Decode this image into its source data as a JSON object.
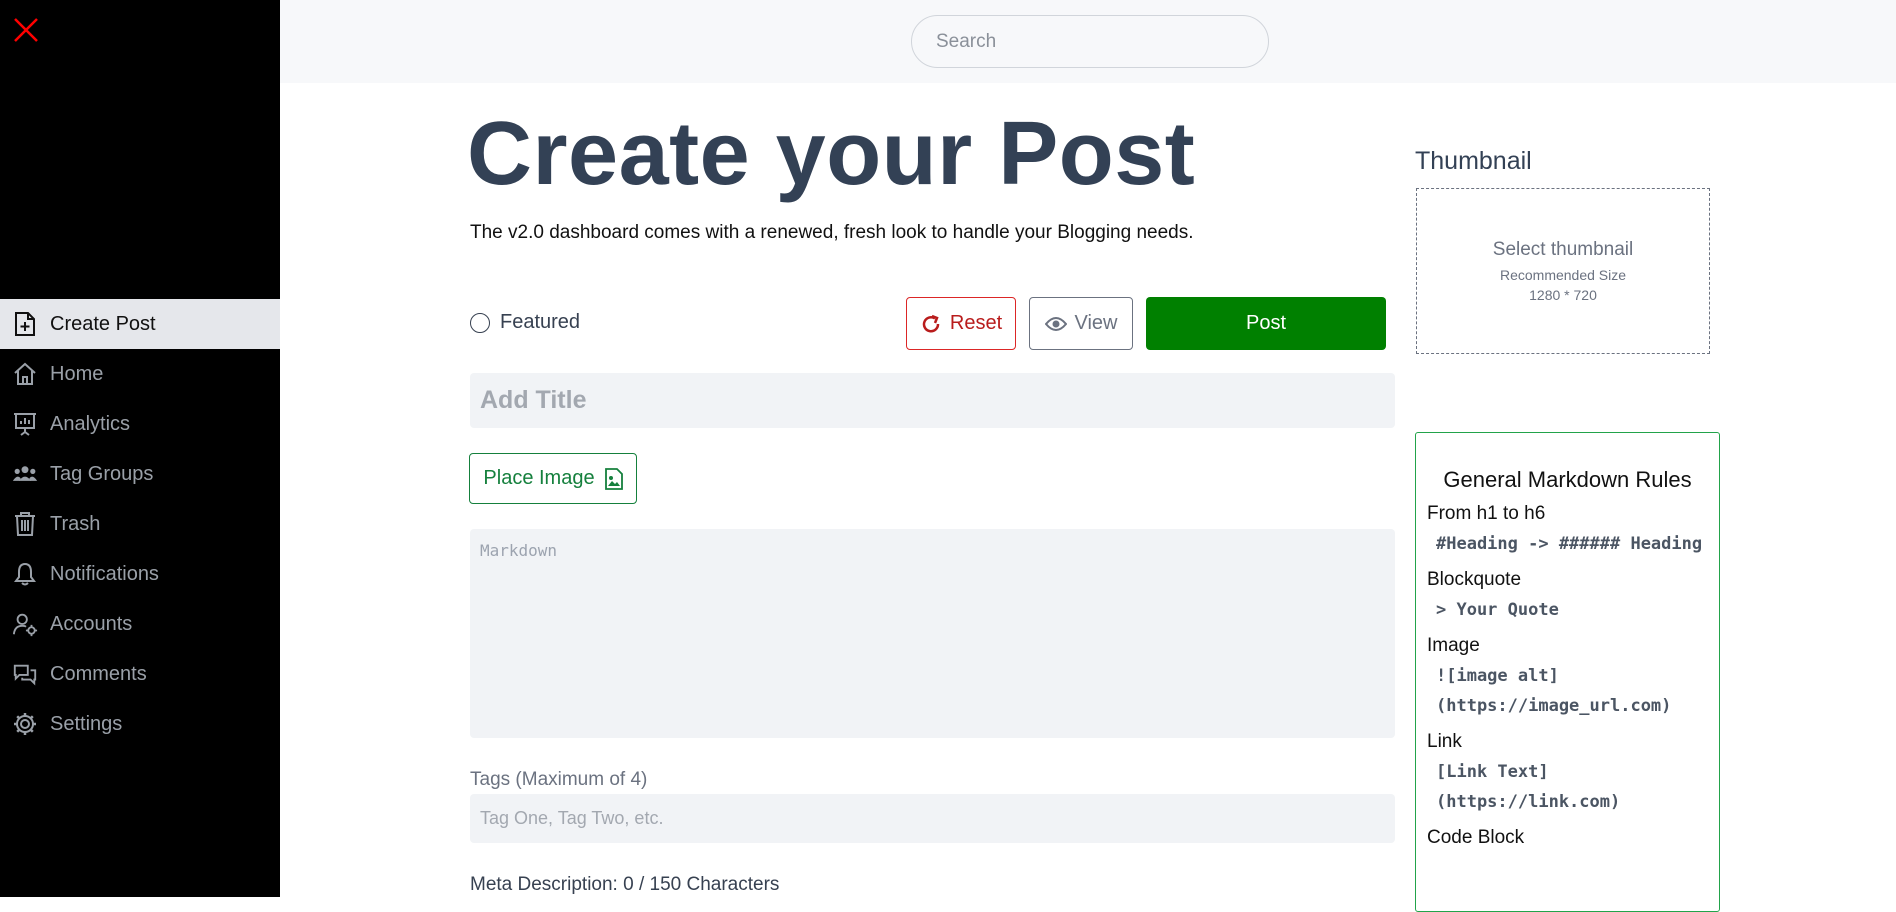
{
  "search": {
    "placeholder": "Search"
  },
  "sidebar": {
    "items": [
      {
        "label": "Create Post",
        "icon": "file-plus-icon",
        "active": true
      },
      {
        "label": "Home",
        "icon": "home-icon"
      },
      {
        "label": "Analytics",
        "icon": "presentation-chart-icon"
      },
      {
        "label": "Tag Groups",
        "icon": "users-icon"
      },
      {
        "label": "Trash",
        "icon": "trash-icon"
      },
      {
        "label": "Notifications",
        "icon": "bell-icon"
      },
      {
        "label": "Accounts",
        "icon": "user-cog-icon"
      },
      {
        "label": "Comments",
        "icon": "chat-icon"
      },
      {
        "label": "Settings",
        "icon": "gear-icon"
      }
    ]
  },
  "main": {
    "title": "Create your Post",
    "subtitle": "The v2.0 dashboard comes with a renewed, fresh look to handle your Blogging needs.",
    "featured_label": "Featured",
    "reset_label": "Reset",
    "view_label": "View",
    "post_label": "Post",
    "title_placeholder": "Add Title",
    "place_image_label": "Place Image",
    "markdown_placeholder": "Markdown",
    "tags_label": "Tags (Maximum of 4)",
    "tags_placeholder": "Tag One, Tag Two, etc.",
    "meta_label": "Meta Description: 0 / 150 Characters"
  },
  "thumbnail": {
    "heading": "Thumbnail",
    "select_label": "Select thumbnail",
    "recommended_label": "Recommended Size",
    "size_label": "1280 * 720"
  },
  "rules": {
    "title": "General Markdown Rules",
    "items": [
      {
        "name": "From h1 to h6",
        "code": "#Heading -> ###### Heading"
      },
      {
        "name": "Blockquote",
        "code": "> Your Quote"
      },
      {
        "name": "Image",
        "code": "![image alt] (https://image_url.com)"
      },
      {
        "name": "Link",
        "code": "[Link Text] (https://link.com)"
      },
      {
        "name": "Code Block",
        "code": ""
      }
    ]
  },
  "colors": {
    "accent_green": "#008000",
    "reset_red": "#dc2626",
    "close_red": "#ff0000"
  }
}
